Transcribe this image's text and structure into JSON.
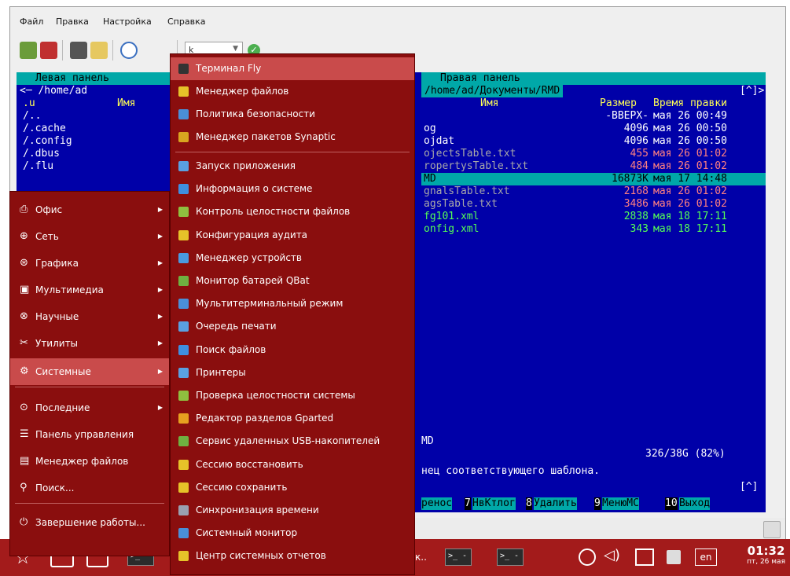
{
  "window": {
    "menubar": [
      "Файл",
      "Правка",
      "Настройка",
      "Справка"
    ],
    "combo_value": "k",
    "terminal": {
      "left_title": "Левая панель",
      "right_title": "Правая панель",
      "left_path": "<─ /home/ad",
      "right_path": "/home/ad/Документы/RMD",
      "left_header_u": ".u",
      "left_header_name": "Имя",
      "left_files": [
        "/..",
        "/.cache",
        "/.config",
        "/.dbus",
        "/.flu"
      ],
      "right_headers": {
        "name": "Имя",
        "size": "Размер",
        "time": "Время правки"
      },
      "right_rows": [
        {
          "name": "",
          "size": "-ВВЕРХ-",
          "time": "мая 26 00:49",
          "style": "white"
        },
        {
          "name": "og",
          "size": "4096",
          "time": "мая 26 00:50",
          "style": "white"
        },
        {
          "name": "ojdat",
          "size": "4096",
          "time": "мая 26 00:50",
          "style": "white"
        },
        {
          "name": "ojectsTable.txt",
          "size": "455",
          "time": "мая 26 01:02",
          "style": "gray"
        },
        {
          "name": "ropertysTable.txt",
          "size": "484",
          "time": "мая 26 01:02",
          "style": "gray"
        },
        {
          "name": "MD",
          "size": "16873K",
          "time": "мая 17 14:48",
          "style": "selected"
        },
        {
          "name": "gnalsTable.txt",
          "size": "2168",
          "time": "мая 26 01:02",
          "style": "gray"
        },
        {
          "name": "agsTable.txt",
          "size": "3486",
          "time": "мая 26 01:02",
          "style": "gray"
        },
        {
          "name": "fg101.xml",
          "size": "2838",
          "time": "мая 18 17:11",
          "style": "green"
        },
        {
          "name": "onfig.xml",
          "size": "343",
          "time": "мая 18 17:11",
          "style": "green"
        }
      ],
      "bottom_name": "MD",
      "disk_info": "326/38G (82%)",
      "hint_line": "нец соответствующего шаблона.",
      "bracket": "[^]",
      "right_path_marker": "[^]>",
      "fkeys": [
        {
          "num": "",
          "label": "ренос"
        },
        {
          "num": "7",
          "label": "НвКтлог"
        },
        {
          "num": "8",
          "label": "Удалить"
        },
        {
          "num": "9",
          "label": "МенюМС"
        },
        {
          "num": "10",
          "label": "Выход"
        }
      ]
    }
  },
  "start_menu": {
    "items": [
      {
        "label": "Офис",
        "icon": "office-icon",
        "submenu": true
      },
      {
        "label": "Сеть",
        "icon": "network-icon",
        "submenu": true
      },
      {
        "label": "Графика",
        "icon": "graphics-icon",
        "submenu": true
      },
      {
        "label": "Мультимедиа",
        "icon": "multimedia-icon",
        "submenu": true
      },
      {
        "label": "Научные",
        "icon": "science-icon",
        "submenu": true
      },
      {
        "label": "Утилиты",
        "icon": "utilities-icon",
        "submenu": true
      },
      {
        "label": "Системные",
        "icon": "system-icon",
        "submenu": true,
        "selected": true
      },
      {
        "label": "Последние",
        "icon": "recent-icon",
        "submenu": true
      },
      {
        "label": "Панель управления",
        "icon": "control-panel-icon",
        "submenu": false
      },
      {
        "label": "Менеджер файлов",
        "icon": "file-manager-icon",
        "submenu": false
      },
      {
        "label": "Поиск...",
        "icon": "search-icon",
        "submenu": false
      },
      {
        "label": "Завершение работы...",
        "icon": "shutdown-icon",
        "submenu": false
      }
    ]
  },
  "submenu": {
    "items": [
      {
        "label": "Терминал Fly",
        "color": "#333333",
        "selected": true
      },
      {
        "label": "Менеджер файлов",
        "color": "#e6c229"
      },
      {
        "label": "Политика безопасности",
        "color": "#4a8fd8"
      },
      {
        "label": "Менеджер пакетов Synaptic",
        "color": "#d9a520"
      },
      {
        "label": "Запуск приложения",
        "color": "#5aa0e0"
      },
      {
        "label": "Информация о системе",
        "color": "#3f8fe0"
      },
      {
        "label": "Контроль целостности файлов",
        "color": "#8fbf3f"
      },
      {
        "label": "Конфигурация аудита",
        "color": "#e6c229"
      },
      {
        "label": "Менеджер устройств",
        "color": "#4a9ae0"
      },
      {
        "label": "Монитор батарей QBat",
        "color": "#6fb040"
      },
      {
        "label": "Мультитерминальный режим",
        "color": "#4a8fd8"
      },
      {
        "label": "Очередь печати",
        "color": "#5aa0e0"
      },
      {
        "label": "Поиск файлов",
        "color": "#3f8fe0"
      },
      {
        "label": "Принтеры",
        "color": "#5aa0e0"
      },
      {
        "label": "Проверка целостности системы",
        "color": "#8fbf3f"
      },
      {
        "label": "Редактор разделов Gparted",
        "color": "#e6a020"
      },
      {
        "label": "Сервис удаленных USB-накопителей",
        "color": "#6fb040"
      },
      {
        "label": "Сессию восстановить",
        "color": "#e6c229"
      },
      {
        "label": "Сессию сохранить",
        "color": "#e6c229"
      },
      {
        "label": "Синхронизация времени",
        "color": "#9aa0b0"
      },
      {
        "label": "Системный монитор",
        "color": "#4a8fd8"
      },
      {
        "label": "Центр системных отчетов",
        "color": "#e6c229"
      }
    ]
  },
  "taskbar": {
    "lang": "en",
    "time": "01:32",
    "date": "пт, 26 мая",
    "term_labels": [
      ">_ -",
      ">_ -",
      ">_ -"
    ],
    "partial": "к.."
  }
}
